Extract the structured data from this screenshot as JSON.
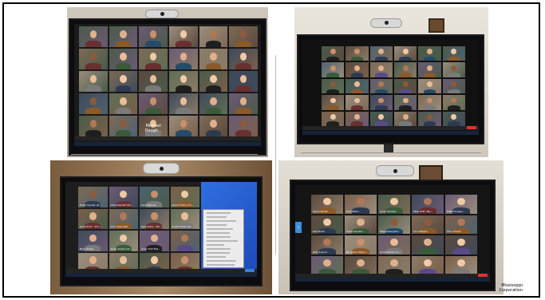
{
  "photos": [
    {
      "id": "top-left",
      "name_tag": "Michael Dough..."
    },
    {
      "id": "top-right"
    },
    {
      "id": "bottom-left",
      "names": [
        "Frank Snyder (O...",
        "Chris Dewalt (He...",
        "Sara Werner",
        "Jackl O'Hara (Th...",
        "John Rubin - Em...",
        "John Olsen Bill",
        "Kyle Salas - Tob...",
        "Anabl Fisher (M...",
        "Brian Fisher",
        "Andy Santen Vic...",
        "Andy Holt Fills..."
      ]
    },
    {
      "id": "bottom-right",
      "names": [
        "Steve Winter",
        "Kurt Mitch...",
        "Andy Sobolek",
        "Mike Doff - Ba...",
        "Matt Sturgen...",
        "Dad Nerbi",
        "Travis Snyder...",
        "Stephanie Jane...",
        "Lori Gilligan",
        "Tony Frazier",
        "Jack Traynor",
        "Benjamin Palms...",
        "Andy Santen Fu..."
      ]
    }
  ],
  "caption": [
    "Mississippi",
    "Corporation"
  ]
}
